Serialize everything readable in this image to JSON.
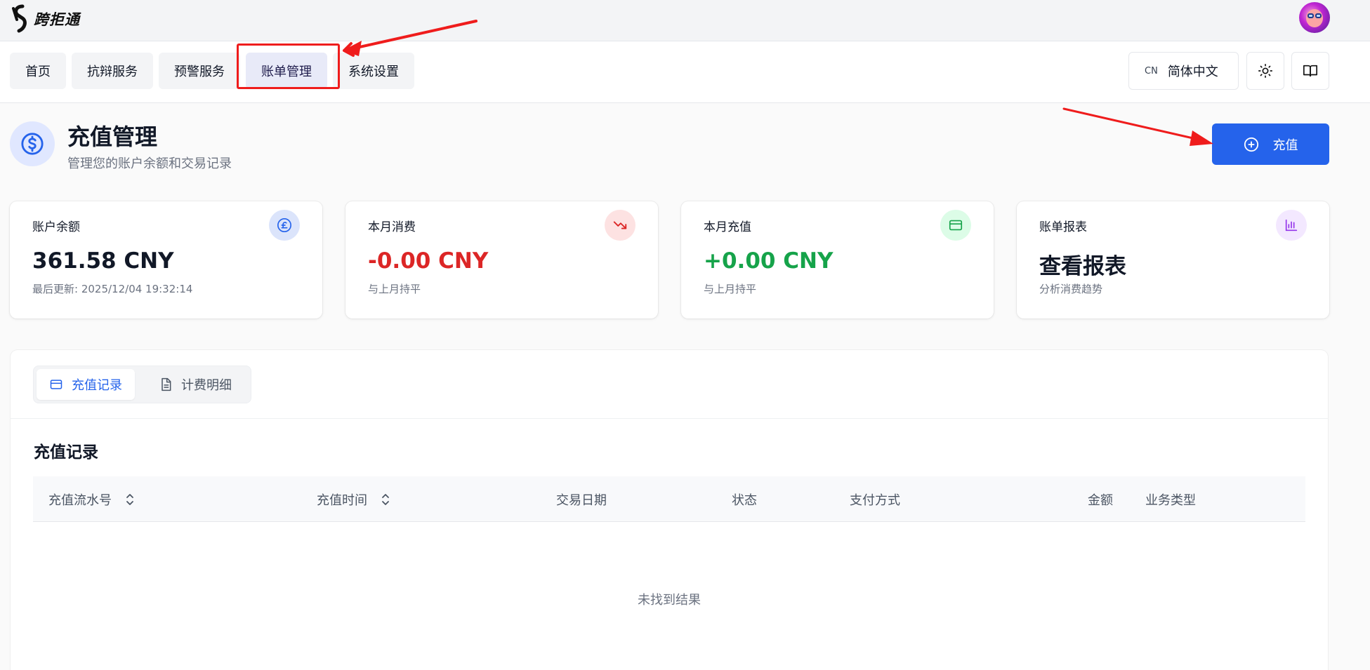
{
  "brand": {
    "name": "跨拒通",
    "logo_icon": "s-logo-icon"
  },
  "user": {
    "avatar_icon": "avatar-icon"
  },
  "nav": {
    "tabs": [
      {
        "label": "首页"
      },
      {
        "label": "抗辩服务"
      },
      {
        "label": "预警服务"
      },
      {
        "label": "账单管理",
        "active": true
      },
      {
        "label": "系统设置"
      }
    ],
    "language": {
      "code": "CN",
      "label": "简体中文"
    },
    "theme_icon": "sun-icon",
    "docs_icon": "book-icon"
  },
  "page": {
    "icon": "dollar-icon",
    "title": "充值管理",
    "subtitle": "管理您的账户余额和交易记录",
    "recharge_button": "充值"
  },
  "stats": [
    {
      "label": "账户余额",
      "value": "361.58 CNY",
      "sub": "最后更新: 2025/12/04 19:32:14",
      "icon": "pound-icon",
      "color": "#111827"
    },
    {
      "label": "本月消费",
      "value": "-0.00 CNY",
      "sub": "与上月持平",
      "icon": "trending-down-icon",
      "color": "#dc2626"
    },
    {
      "label": "本月充值",
      "value": "+0.00 CNY",
      "sub": "与上月持平",
      "icon": "credit-card-icon",
      "color": "#16a34a"
    },
    {
      "label": "账单报表",
      "value": "查看报表",
      "sub": "分析消费趋势",
      "icon": "bar-chart-icon",
      "color": "#111827"
    }
  ],
  "records": {
    "tabs": [
      {
        "label": "充值记录",
        "icon": "credit-card-icon",
        "active": true
      },
      {
        "label": "计费明细",
        "icon": "document-icon"
      }
    ],
    "section_title": "充值记录",
    "columns": [
      "充值流水号",
      "充值时间",
      "交易日期",
      "状态",
      "支付方式",
      "金额",
      "业务类型"
    ],
    "empty_text": "未找到结果"
  },
  "colors": {
    "primary": "#2563eb",
    "negative": "#dc2626",
    "positive": "#16a34a",
    "annotation": "#ef1c1c"
  }
}
